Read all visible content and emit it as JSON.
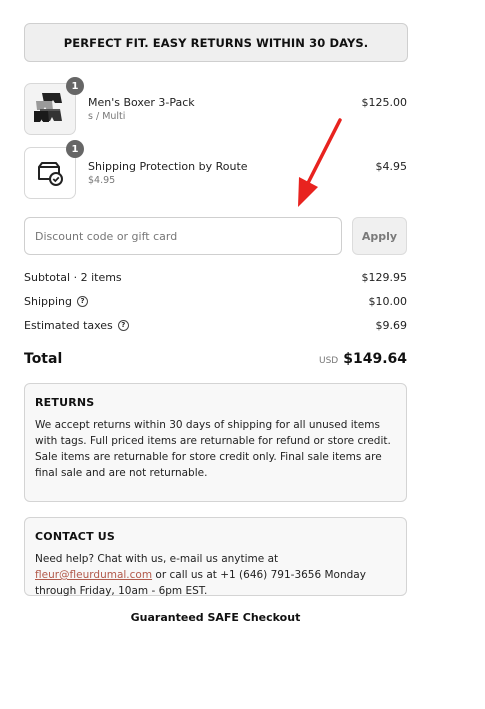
{
  "banner": {
    "text": "PERFECT FIT. EASY RETURNS WITHIN 30 DAYS."
  },
  "items": [
    {
      "qty": "1",
      "name": "Men's Boxer 3-Pack",
      "variant": "s / Multi",
      "price": "$125.00",
      "icon": "boxer-shorts-image"
    },
    {
      "qty": "1",
      "name": "Shipping Protection by Route",
      "variant": "$4.95",
      "price": "$4.95",
      "icon": "shipping-protection-icon"
    }
  ],
  "discount": {
    "placeholder": "Discount code or gift card",
    "apply_label": "Apply"
  },
  "summary": {
    "subtotal_label": "Subtotal · 2 items",
    "subtotal_value": "$129.95",
    "shipping_label": "Shipping",
    "shipping_value": "$10.00",
    "taxes_label": "Estimated taxes",
    "taxes_value": "$9.69",
    "help_icon": "?"
  },
  "total": {
    "label": "Total",
    "currency": "USD",
    "amount": "$149.64"
  },
  "returns": {
    "title": "RETURNS",
    "body": "We accept returns within 30 days of shipping for all unused items with tags. Full priced items are returnable for refund or store credit. Sale items are returnable for store credit only. Final sale items are final sale and are not returnable."
  },
  "contact": {
    "title": "CONTACT US",
    "body_before": "Need help? Chat with us, e-mail us anytime at ",
    "email": "fleur@fleurdumal.com",
    "body_after": " or call us at +1 (646) 791-3656 Monday through Friday, 10am - 6pm EST."
  },
  "footer": {
    "safe_checkout": "Guaranteed SAFE Checkout"
  },
  "colors": {
    "accent_link": "#b25a4b",
    "annotation_arrow": "#e8231f"
  }
}
